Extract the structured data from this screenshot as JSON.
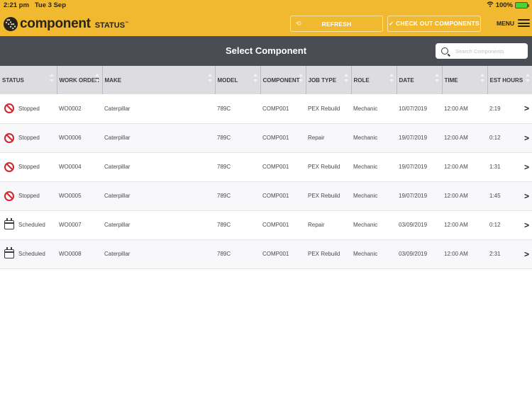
{
  "statusbar": {
    "time": "2:21 pm",
    "date": "Tue 3 Sep",
    "battery": "100%"
  },
  "header": {
    "logo_main": "component",
    "logo_sub": "STATUS",
    "logo_tm": "™",
    "refresh_label": "REFRESH",
    "checkout_label": "✓ CHECK OUT COMPONENTS",
    "menu_label": "MENU"
  },
  "titlebar": {
    "title": "Select Component",
    "search_placeholder": "Search Components",
    "search_value": ""
  },
  "table": {
    "columns": [
      "STATUS",
      "WORK ORDER",
      "MAKE",
      "MODEL",
      "COMPONENT",
      "JOB TYPE",
      "ROLE",
      "DATE",
      "TIME",
      "EST HOURS"
    ],
    "rows": [
      {
        "status": "Stopped",
        "status_icon": "stop-icon",
        "work_order": "WO0002",
        "make": "Caterpillar",
        "model": "789C",
        "component": "COMP001",
        "job_type": "PEX Rebuild",
        "role": "Mechanic",
        "date": "10/07/2019",
        "time": "12:00 AM",
        "est_hours": "2:19"
      },
      {
        "status": "Stopped",
        "status_icon": "stop-icon",
        "work_order": "WO0006",
        "make": "Caterpillar",
        "model": "789C",
        "component": "COMP001",
        "job_type": "Repair",
        "role": "Mechanic",
        "date": "19/07/2019",
        "time": "12:00 AM",
        "est_hours": "0:12"
      },
      {
        "status": "Stopped",
        "status_icon": "stop-icon",
        "work_order": "WO0004",
        "make": "Caterpillar",
        "model": "789C",
        "component": "COMP001",
        "job_type": "PEX Rebuild",
        "role": "Mechanic",
        "date": "19/07/2019",
        "time": "12:00 AM",
        "est_hours": "1:31"
      },
      {
        "status": "Stopped",
        "status_icon": "stop-icon",
        "work_order": "WO0005",
        "make": "Caterpillar",
        "model": "789C",
        "component": "COMP001",
        "job_type": "PEX Rebuild",
        "role": "Mechanic",
        "date": "19/07/2019",
        "time": "12:00 AM",
        "est_hours": "1:45"
      },
      {
        "status": "Scheduled",
        "status_icon": "calendar-icon",
        "work_order": "WO0007",
        "make": "Caterpillar",
        "model": "789C",
        "component": "COMP001",
        "job_type": "Repair",
        "role": "Mechanic",
        "date": "03/09/2019",
        "time": "12:00 AM",
        "est_hours": "0:12"
      },
      {
        "status": "Scheduled",
        "status_icon": "calendar-icon",
        "work_order": "WO0008",
        "make": "Caterpillar",
        "model": "789C",
        "component": "COMP001",
        "job_type": "PEX Rebuild",
        "role": "Mechanic",
        "date": "03/09/2019",
        "time": "12:00 AM",
        "est_hours": "2:31"
      }
    ]
  },
  "colors": {
    "brand": "#f0b92f",
    "titlebar": "#4b4d54",
    "stopped": "#d0262e"
  }
}
